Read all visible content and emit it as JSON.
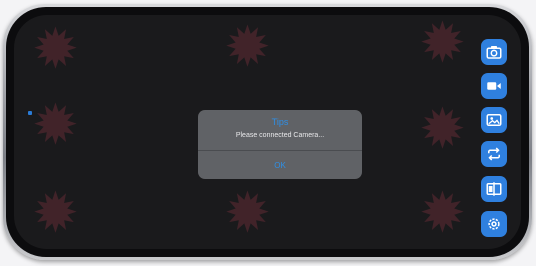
{
  "dialog": {
    "title": "Tips",
    "message": "Please connected Camera...",
    "ok_label": "OK"
  },
  "side_toolbar": {
    "buttons": [
      {
        "name": "camera-photo-button",
        "icon": "camera-icon"
      },
      {
        "name": "video-record-button",
        "icon": "video-camera-icon"
      },
      {
        "name": "gallery-button",
        "icon": "image-icon"
      },
      {
        "name": "switch-camera-button",
        "icon": "repeat-icon"
      },
      {
        "name": "split-view-button",
        "icon": "split-view-icon"
      },
      {
        "name": "settings-button",
        "icon": "gear-icon"
      }
    ]
  },
  "colors": {
    "accent": "#2e8fe6",
    "button_bg": "#2f80df",
    "dialog_bg": "#606266",
    "screen_bg": "#1a1a1c",
    "watermark": "#cd465a"
  }
}
